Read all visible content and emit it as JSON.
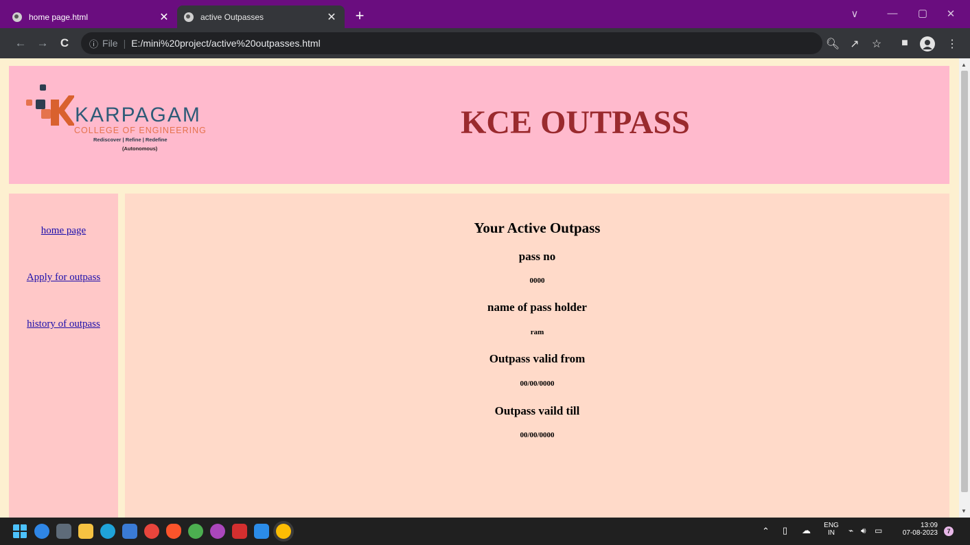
{
  "browser": {
    "tabs": [
      {
        "title": "home page.html",
        "close": "✕"
      },
      {
        "title": "active Outpasses",
        "close": "✕"
      }
    ],
    "new_tab": "+",
    "window_controls": [
      "chevron-down-icon",
      "minimize-icon",
      "restore-icon",
      "close-icon"
    ],
    "nav": {
      "back": "←",
      "forward": "→",
      "reload": "C"
    },
    "omnibox": {
      "info": "ⓘ",
      "file_label": "File",
      "separator": "|",
      "url": "E:/mini%20project/active%20outpasses.html"
    },
    "right_icons": [
      "zoom-icon",
      "share-icon",
      "star-icon",
      "side-panel-icon",
      "profile-icon",
      "menu-icon"
    ],
    "colors": {
      "tab_strip": "#6a0d7f",
      "toolbar": "#34363a"
    }
  },
  "page": {
    "logo": {
      "name": "KARPAGAM",
      "subtitle": "COLLEGE OF ENGINEERING",
      "tagline": "Rediscover | Refine | Redefine",
      "autonomous": "(Autonomous)"
    },
    "title": "KCE OUTPASS",
    "sidebar": {
      "links": [
        "home page",
        "Apply for outpass",
        "history of outpass"
      ]
    },
    "main": {
      "heading": "Your Active Outpass",
      "fields": [
        {
          "label": "pass no",
          "value": "0000"
        },
        {
          "label": "name of pass holder",
          "value": "ram"
        },
        {
          "label": "Outpass valid from",
          "value": "00/00/0000"
        },
        {
          "label": "Outpass vaild till",
          "value": "00/00/0000"
        }
      ]
    },
    "colors": {
      "page_bg": "#fdf0d0",
      "header_bg": "#ffbacd",
      "sidebar_bg": "#ffc8c8",
      "content_bg": "#ffdac9",
      "title": "#9a2a2e",
      "link": "#1a0dab"
    }
  },
  "taskbar": {
    "tray": {
      "language": "ENG",
      "region": "IN",
      "time": "13:09",
      "date": "07-08-2023",
      "notifications": "7"
    }
  }
}
